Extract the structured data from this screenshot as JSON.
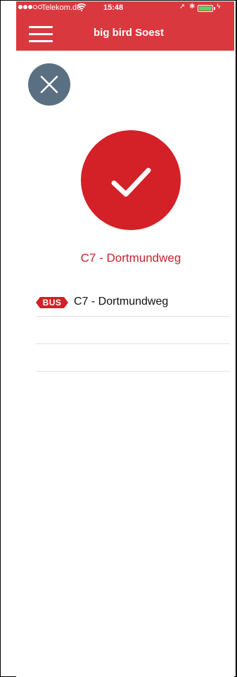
{
  "status_bar": {
    "carrier": "Telekom.de",
    "wifi_icon": "wifi-icon",
    "time": "15:48",
    "location_icon": "➚",
    "bluetooth_icon": "✱",
    "charge_icon": "ϟ",
    "battery_level": 1.0,
    "signal_bars_filled": 3,
    "signal_bars_total": 5
  },
  "nav": {
    "title": "big bird Soest",
    "menu_icon": "hamburger-menu-icon"
  },
  "close_icon": "close-icon",
  "success": {
    "icon": "checkmark-icon",
    "stop_name": "C7 - Dortmundweg"
  },
  "lines": [
    {
      "badge": "BUS",
      "name": "C7 - Dortmundweg"
    },
    {
      "badge": "",
      "name": ""
    },
    {
      "badge": "",
      "name": ""
    }
  ],
  "colors": {
    "brand_red": "#d9393e",
    "success_red": "#d42027",
    "close_gray": "#5b6f82",
    "title_red": "#c8232c"
  }
}
